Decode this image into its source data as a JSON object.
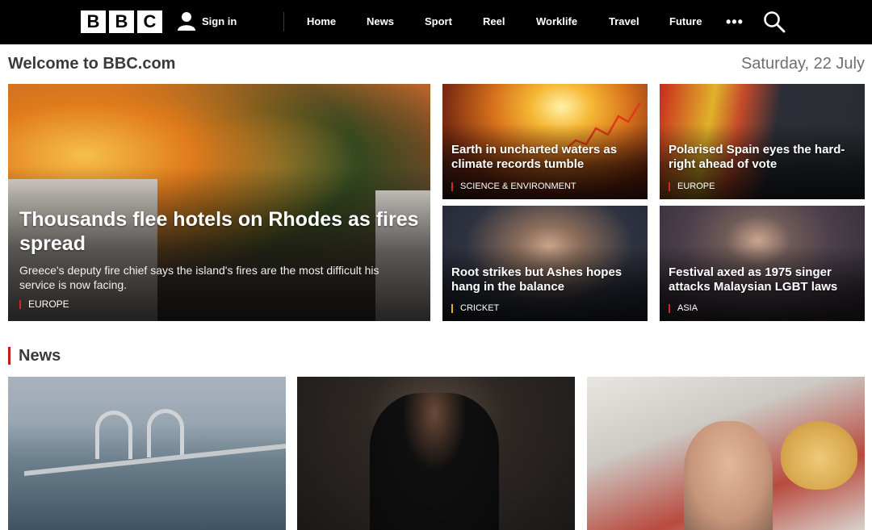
{
  "header": {
    "logo_letters": [
      "B",
      "B",
      "C"
    ],
    "signin_label": "Sign in",
    "nav": [
      "Home",
      "News",
      "Sport",
      "Reel",
      "Worklife",
      "Travel",
      "Future"
    ],
    "more_label": "•••"
  },
  "welcome": {
    "title": "Welcome to BBC.com",
    "date": "Saturday, 22 July"
  },
  "hero": {
    "headline": "Thousands flee hotels on Rhodes as fires spread",
    "summary": "Greece's deputy fire chief says the island's fires are the most difficult his service is now facing.",
    "tag": "EUROPE"
  },
  "stories": [
    {
      "headline": "Earth in uncharted waters as climate records tumble",
      "tag": "SCIENCE & ENVIRONMENT"
    },
    {
      "headline": "Polarised Spain eyes the hard-right ahead of vote",
      "tag": "EUROPE"
    },
    {
      "headline": "Root strikes but Ashes hopes hang in the balance",
      "tag": "CRICKET"
    },
    {
      "headline": "Festival axed as 1975 singer attacks Malaysian LGBT laws",
      "tag": "ASIA"
    }
  ],
  "news_section": {
    "title": "News"
  },
  "colors": {
    "header_bg": "#000000",
    "accent_red": "#c31b1b",
    "cricket_accent": "#e8b500"
  }
}
